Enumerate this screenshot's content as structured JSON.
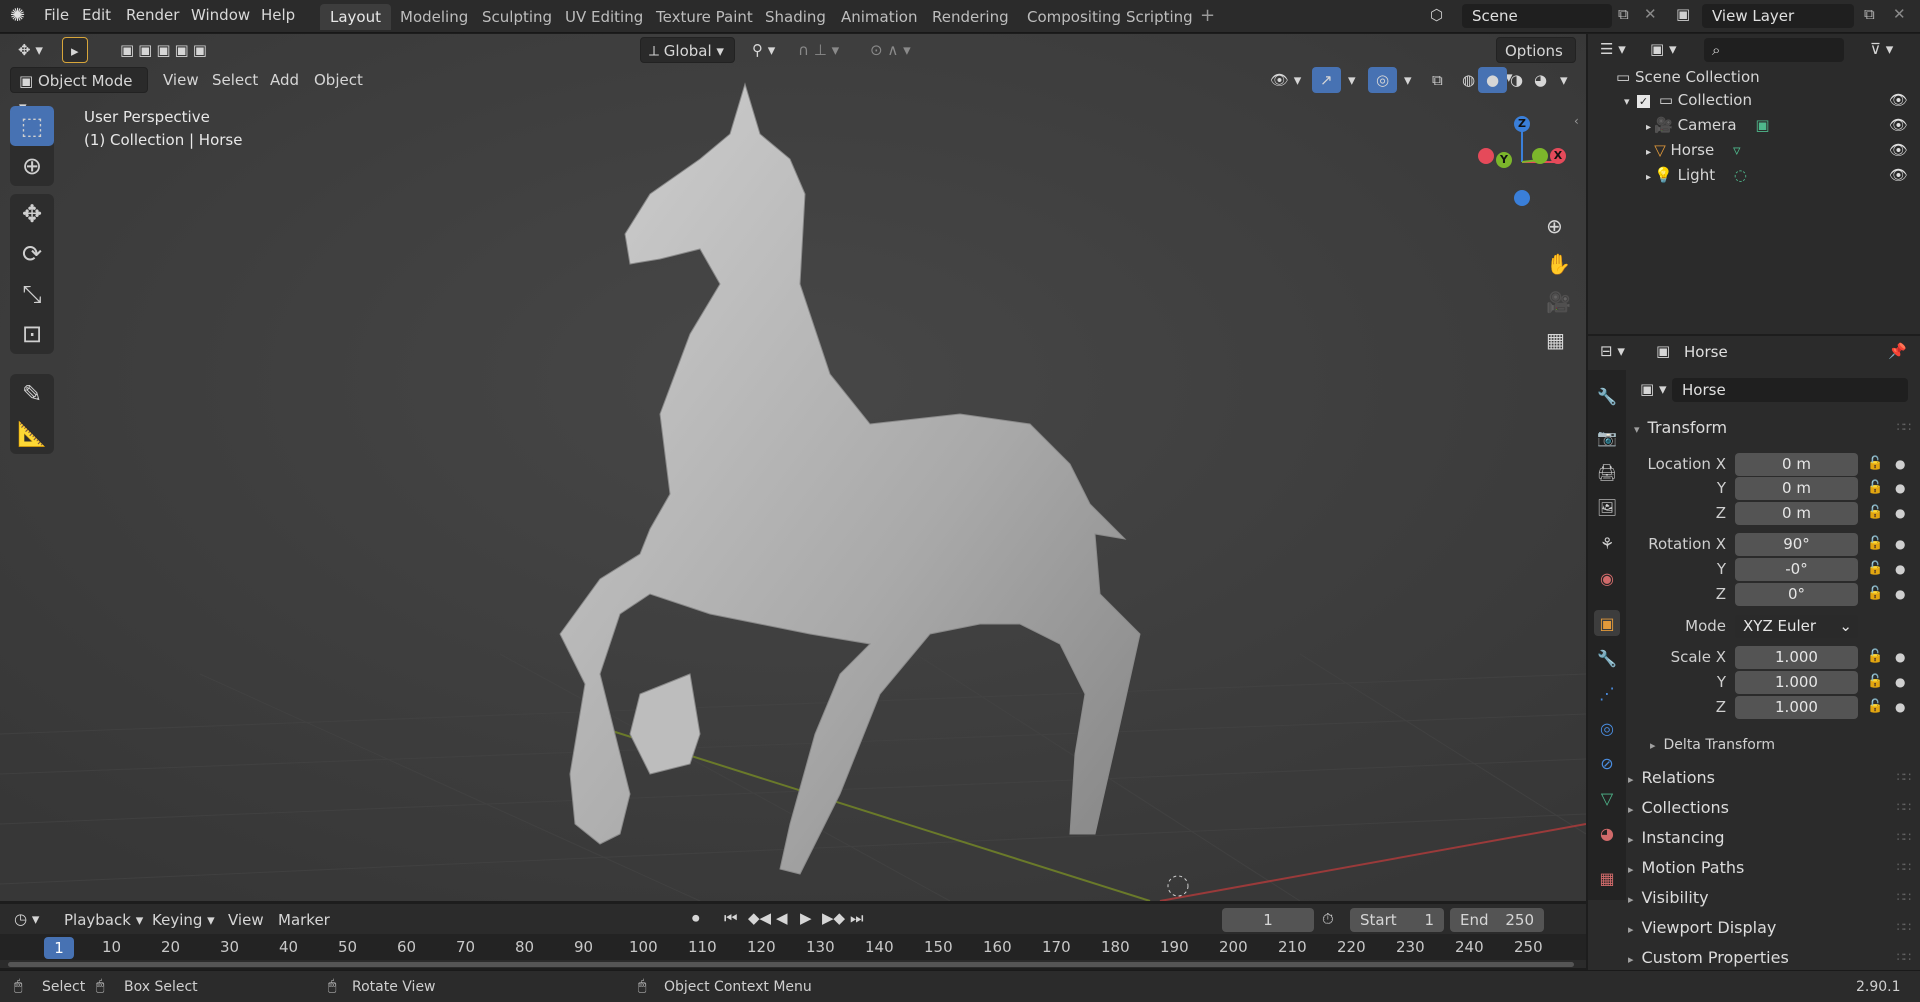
{
  "menu": [
    "File",
    "Edit",
    "Render",
    "Window",
    "Help"
  ],
  "workspaces": [
    "Layout",
    "Modeling",
    "Sculpting",
    "UV Editing",
    "Texture Paint",
    "Shading",
    "Animation",
    "Rendering",
    "Compositing",
    "Scripting"
  ],
  "active_workspace": "Layout",
  "scene": "Scene",
  "view_layer": "View Layer",
  "viewport": {
    "mode": "Object Mode",
    "menus": [
      "View",
      "Select",
      "Add",
      "Object"
    ],
    "orientation": "Global",
    "options_label": "Options",
    "overlay_title": "User Perspective",
    "overlay_sub": "(1) Collection | Horse",
    "gizmo": {
      "z": "Z",
      "y": "Y",
      "x": "X"
    },
    "colors": {
      "x": "#e54a5a",
      "y": "#7cb62b",
      "z": "#3a7fd9",
      "active": "#4772b3"
    }
  },
  "outliner": {
    "root": "Scene Collection",
    "collection": "Collection",
    "items": [
      "Camera",
      "Horse",
      "Light"
    ]
  },
  "properties": {
    "object_name": "Horse",
    "data_name": "Horse",
    "transform_label": "Transform",
    "location": {
      "label": "Location X",
      "x": "0 m",
      "y": "0 m",
      "z": "0 m"
    },
    "rotation": {
      "label": "Rotation X",
      "x": "90°",
      "y": "-0°",
      "z": "0°"
    },
    "mode_label": "Mode",
    "mode_value": "XYZ Euler",
    "scale": {
      "label": "Scale X",
      "x": "1.000",
      "y": "1.000",
      "z": "1.000"
    },
    "axis_y": "Y",
    "axis_z": "Z",
    "delta_transform": "Delta Transform",
    "sections": [
      "Relations",
      "Collections",
      "Instancing",
      "Motion Paths",
      "Visibility",
      "Viewport Display",
      "Custom Properties"
    ]
  },
  "timeline": {
    "menus": [
      "Playback",
      "Keying",
      "View",
      "Marker"
    ],
    "current_frame": "1",
    "start_label": "Start",
    "start": "1",
    "end_label": "End",
    "end": "250",
    "ruler": [
      "1",
      "10",
      "20",
      "30",
      "40",
      "50",
      "60",
      "70",
      "80",
      "90",
      "100",
      "110",
      "120",
      "130",
      "140",
      "150",
      "160",
      "170",
      "180",
      "190",
      "200",
      "210",
      "220",
      "230",
      "240",
      "250"
    ]
  },
  "status": {
    "select": "Select",
    "box_select": "Box Select",
    "rotate_view": "Rotate View",
    "context_menu": "Object Context Menu",
    "version": "2.90.1"
  }
}
